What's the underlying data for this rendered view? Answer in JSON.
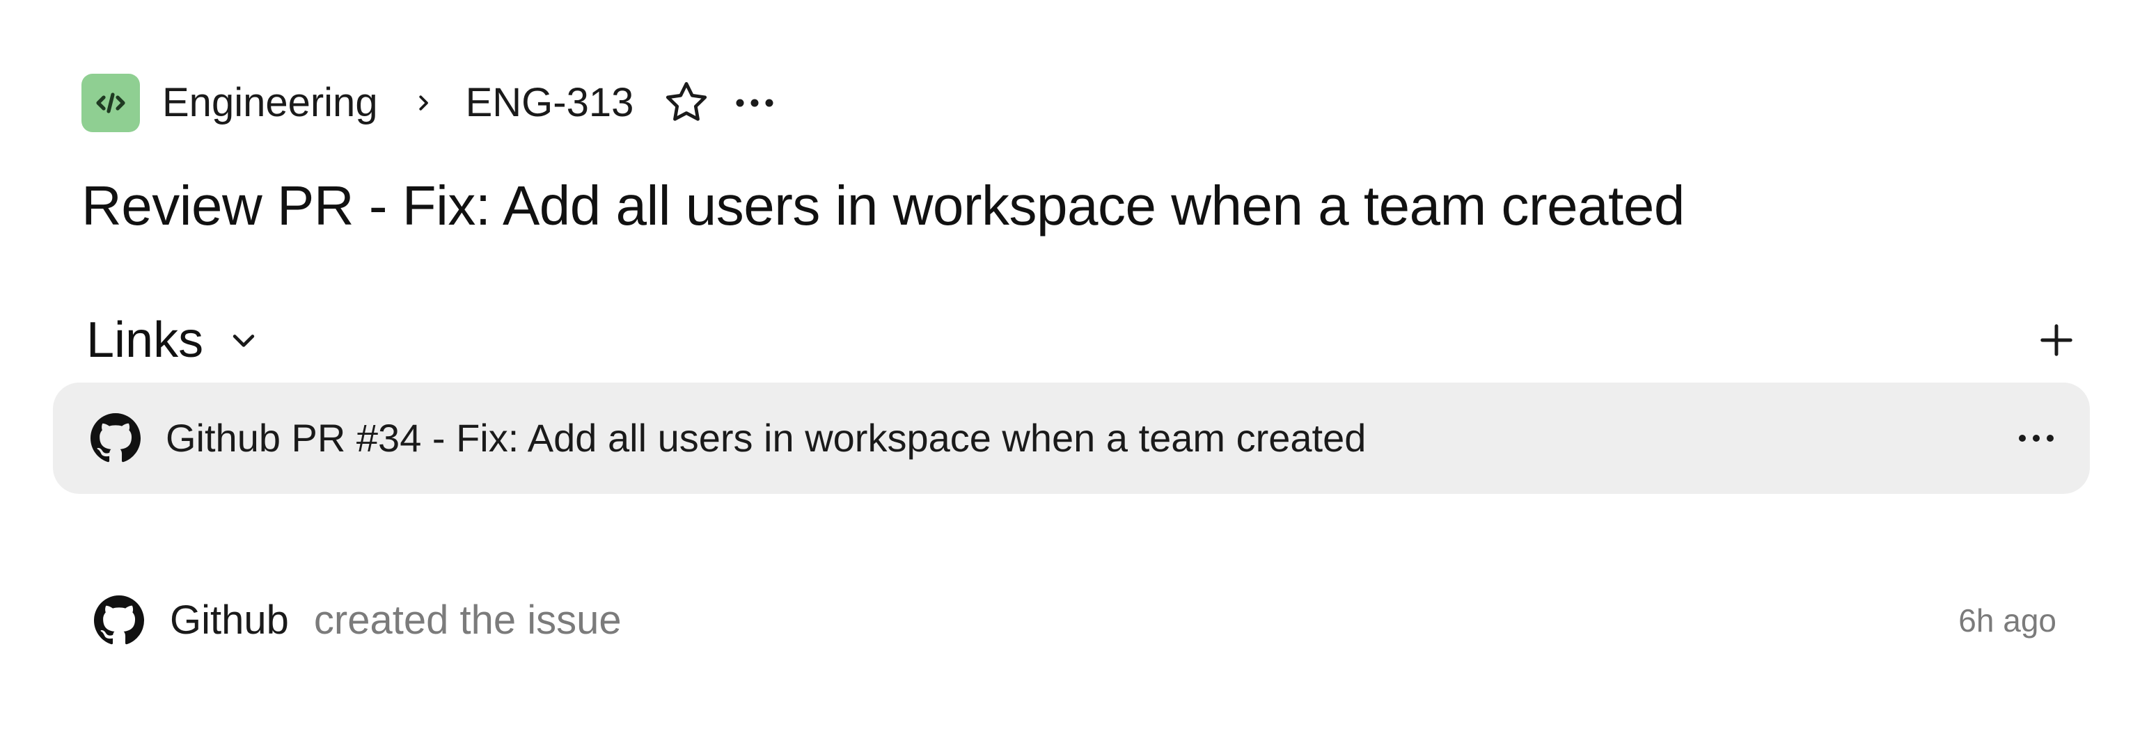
{
  "breadcrumb": {
    "team_icon": "code-icon",
    "team_color": "#8fcf92",
    "team": "Engineering",
    "separator_icon": "chevron-right-icon",
    "issue_id": "ENG-313",
    "favorite_icon": "star-icon",
    "more_icon": "more-horizontal-icon"
  },
  "issue": {
    "title": "Review PR - Fix: Add all users in workspace when a team created"
  },
  "links": {
    "section_label": "Links",
    "toggle_icon": "chevron-down-icon",
    "add_icon": "plus-icon",
    "items": [
      {
        "icon": "github-icon",
        "label": "Github PR #34 - Fix: Add all users in workspace when a team created",
        "more_icon": "more-horizontal-icon"
      }
    ],
    "row_background": "#eeeeee"
  },
  "activity": {
    "items": [
      {
        "icon": "github-icon",
        "actor": "Github",
        "action": "created the issue",
        "time": "6h ago"
      }
    ]
  }
}
